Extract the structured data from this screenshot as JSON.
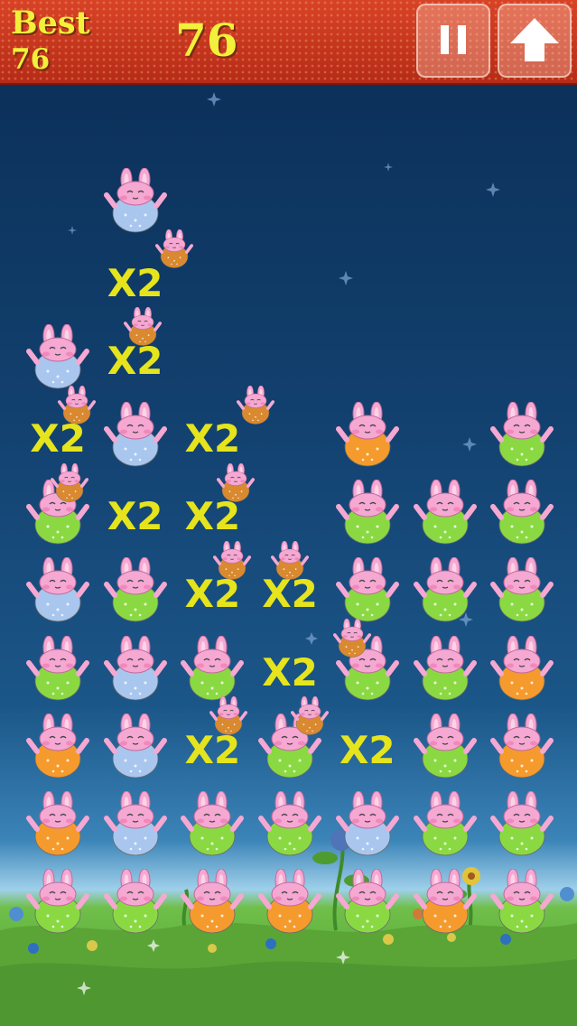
{
  "hud": {
    "best_label": "Best",
    "best_value": "76",
    "score": "76"
  },
  "buttons": {
    "pause_icon": "pause-icon",
    "up_icon": "up-arrow-icon"
  },
  "colors": {
    "header": "#c93620",
    "hud_text": "#f2f03a",
    "multiplier_text": "#e6e41c",
    "bunny_green": "#8ad942",
    "bunny_orange": "#f59a2c",
    "bunny_blue": "#a9c6ee",
    "bunny_ears": "#f5a8d2",
    "small_bunny": "#d9892f"
  },
  "grid": {
    "columns": 7,
    "rows": 11
  },
  "bunnies": [
    {
      "col": 0,
      "row": 4,
      "color": "blue"
    },
    {
      "col": 0,
      "row": 6,
      "color": "green"
    },
    {
      "col": 0,
      "row": 7,
      "color": "blue"
    },
    {
      "col": 0,
      "row": 8,
      "color": "green"
    },
    {
      "col": 0,
      "row": 9,
      "color": "orange"
    },
    {
      "col": 0,
      "row": 10,
      "color": "orange"
    },
    {
      "col": 0,
      "row": 11,
      "color": "green"
    },
    {
      "col": 1,
      "row": 2,
      "color": "blue"
    },
    {
      "col": 1,
      "row": 5,
      "color": "blue"
    },
    {
      "col": 1,
      "row": 7,
      "color": "green"
    },
    {
      "col": 1,
      "row": 8,
      "color": "blue"
    },
    {
      "col": 1,
      "row": 9,
      "color": "blue"
    },
    {
      "col": 1,
      "row": 10,
      "color": "blue"
    },
    {
      "col": 1,
      "row": 11,
      "color": "green"
    },
    {
      "col": 2,
      "row": 8,
      "color": "green"
    },
    {
      "col": 2,
      "row": 10,
      "color": "green"
    },
    {
      "col": 2,
      "row": 11,
      "color": "orange"
    },
    {
      "col": 3,
      "row": 9,
      "color": "green"
    },
    {
      "col": 3,
      "row": 10,
      "color": "green"
    },
    {
      "col": 3,
      "row": 11,
      "color": "orange"
    },
    {
      "col": 4,
      "row": 5,
      "color": "orange"
    },
    {
      "col": 4,
      "row": 6,
      "color": "green"
    },
    {
      "col": 4,
      "row": 7,
      "color": "green"
    },
    {
      "col": 4,
      "row": 8,
      "color": "green"
    },
    {
      "col": 4,
      "row": 10,
      "color": "blue"
    },
    {
      "col": 4,
      "row": 11,
      "color": "green"
    },
    {
      "col": 5,
      "row": 6,
      "color": "green"
    },
    {
      "col": 5,
      "row": 7,
      "color": "green"
    },
    {
      "col": 5,
      "row": 8,
      "color": "green"
    },
    {
      "col": 5,
      "row": 9,
      "color": "green"
    },
    {
      "col": 5,
      "row": 10,
      "color": "green"
    },
    {
      "col": 5,
      "row": 11,
      "color": "orange"
    },
    {
      "col": 6,
      "row": 5,
      "color": "green"
    },
    {
      "col": 6,
      "row": 6,
      "color": "green"
    },
    {
      "col": 6,
      "row": 7,
      "color": "green"
    },
    {
      "col": 6,
      "row": 8,
      "color": "orange"
    },
    {
      "col": 6,
      "row": 9,
      "color": "orange"
    },
    {
      "col": 6,
      "row": 10,
      "color": "green"
    },
    {
      "col": 6,
      "row": 11,
      "color": "green"
    }
  ],
  "small_bunnies": [
    {
      "col": 1.5,
      "row": 2.6
    },
    {
      "col": 1.1,
      "row": 3.6
    },
    {
      "col": 0.25,
      "row": 4.6
    },
    {
      "col": 0.15,
      "row": 5.6
    },
    {
      "col": 2.55,
      "row": 4.6
    },
    {
      "col": 2.3,
      "row": 5.6
    },
    {
      "col": 2.25,
      "row": 6.6
    },
    {
      "col": 3.0,
      "row": 6.6
    },
    {
      "col": 3.8,
      "row": 7.6
    },
    {
      "col": 2.2,
      "row": 8.6
    },
    {
      "col": 3.25,
      "row": 8.6
    }
  ],
  "multipliers": [
    {
      "col": 1,
      "row": 3,
      "label": "X2"
    },
    {
      "col": 1,
      "row": 4,
      "label": "X2"
    },
    {
      "col": 0,
      "row": 5,
      "label": "X2"
    },
    {
      "col": 2,
      "row": 5,
      "label": "X2"
    },
    {
      "col": 1,
      "row": 6,
      "label": "X2"
    },
    {
      "col": 2,
      "row": 6,
      "label": "X2"
    },
    {
      "col": 2,
      "row": 7,
      "label": "X2"
    },
    {
      "col": 3,
      "row": 7,
      "label": "X2"
    },
    {
      "col": 3,
      "row": 8,
      "label": "X2"
    },
    {
      "col": 2,
      "row": 9,
      "label": "X2"
    },
    {
      "col": 4,
      "row": 9,
      "label": "X2"
    }
  ]
}
